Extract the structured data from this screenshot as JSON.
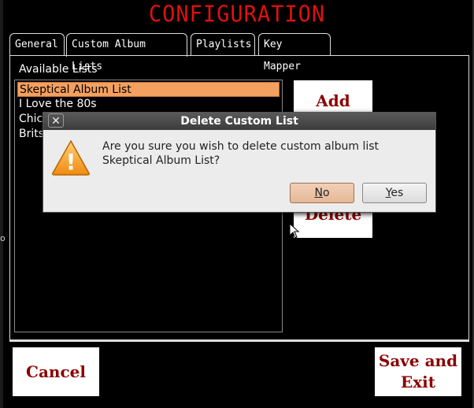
{
  "window": {
    "title": "CONFIGURATION"
  },
  "tabs": [
    {
      "label": "General"
    },
    {
      "label": "Custom Album Lists"
    },
    {
      "label": "Playlists"
    },
    {
      "label": "Key Mapper"
    }
  ],
  "panel": {
    "available_label": "Available Lists",
    "lists": [
      "Skeptical Album List",
      "I Love the 80s",
      "Chick",
      "Brits"
    ],
    "selected_index": 0
  },
  "side_buttons": {
    "add": "Add",
    "delete": "Delete"
  },
  "bottom_buttons": {
    "cancel": "Cancel",
    "save_line1": "Save and",
    "save_line2": "Exit"
  },
  "dialog": {
    "title": "Delete Custom List",
    "close_glyph": "✕",
    "message": "Are you sure you wish to delete custom album list Skeptical Album List?",
    "no_label": "No",
    "yes_label": "Yes",
    "warning_glyph": "!"
  },
  "edge_marks": [
    "o"
  ],
  "colors": {
    "title": "#e01010",
    "selected": "#f4a060",
    "button_text": "#8b0000"
  }
}
